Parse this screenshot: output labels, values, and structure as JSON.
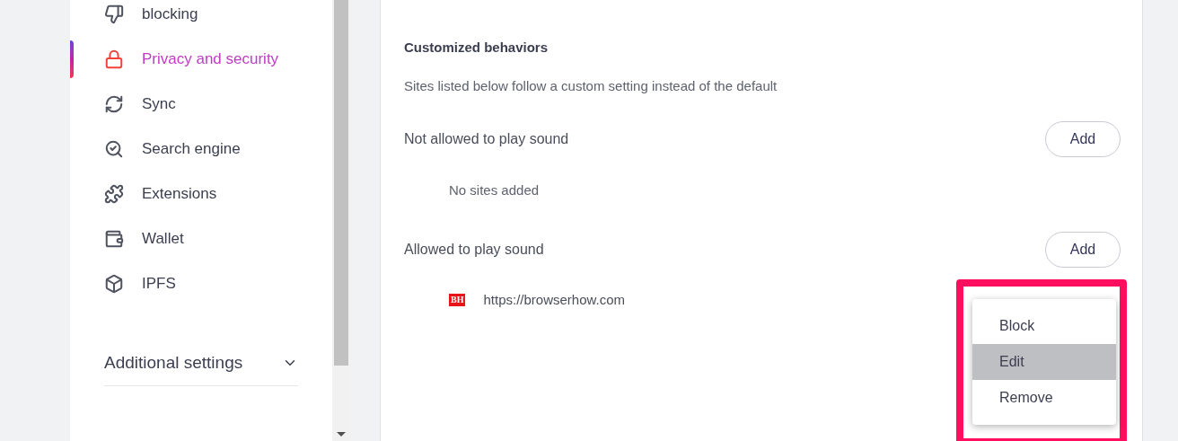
{
  "sidebar": {
    "items": [
      {
        "label": "blocking",
        "selected": false
      },
      {
        "label": "Privacy and security",
        "selected": true
      },
      {
        "label": "Sync",
        "selected": false
      },
      {
        "label": "Search engine",
        "selected": false
      },
      {
        "label": "Extensions",
        "selected": false
      },
      {
        "label": "Wallet",
        "selected": false
      },
      {
        "label": "IPFS",
        "selected": false
      }
    ],
    "additional": {
      "label": "Additional settings",
      "expanded": false
    }
  },
  "content": {
    "heading": "Customized behaviors",
    "description": "Sites listed below follow a custom setting instead of the default",
    "groups": [
      {
        "title": "Not allowed to play sound",
        "button": "Add",
        "empty": "No sites added"
      },
      {
        "title": "Allowed to play sound",
        "button": "Add",
        "sites": [
          {
            "favicon": "BH",
            "url": "https://browserhow.com"
          }
        ]
      }
    ]
  },
  "context_menu": {
    "items": [
      {
        "label": "Block",
        "selected": false
      },
      {
        "label": "Edit",
        "selected": true
      },
      {
        "label": "Remove",
        "selected": false
      }
    ]
  }
}
